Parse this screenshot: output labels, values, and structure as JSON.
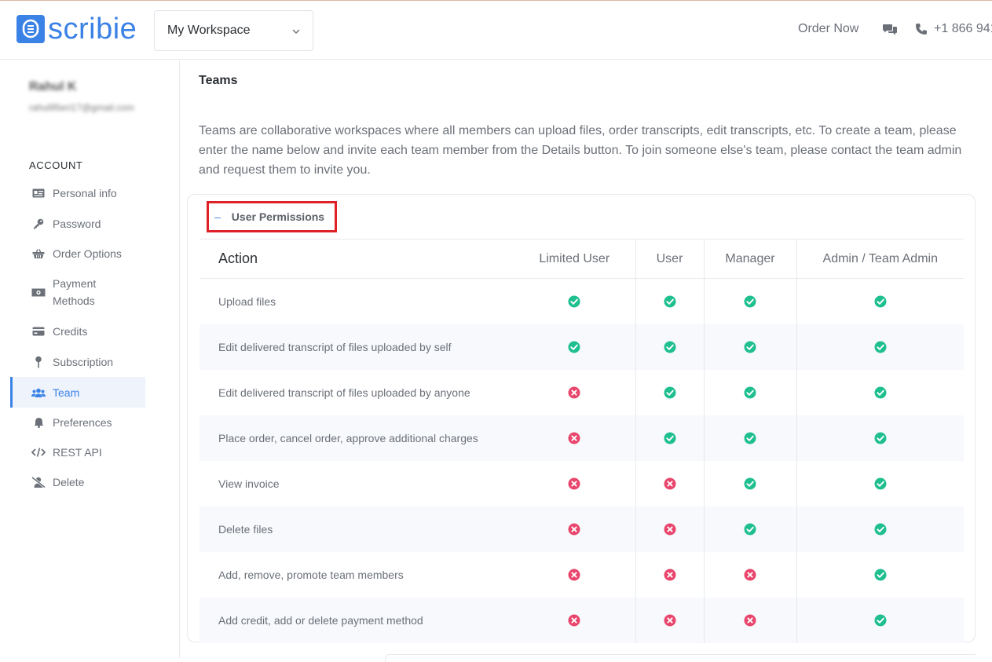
{
  "header": {
    "logo_text": "scribie",
    "workspace": "My Workspace",
    "order_now": "Order Now",
    "phone": "+1 866 941"
  },
  "sidebar": {
    "user_name": "Rahul K",
    "user_email": "rahul95eri17@gmail.com",
    "section": "ACCOUNT",
    "items": [
      {
        "label": "Personal info",
        "icon": "id-card-icon"
      },
      {
        "label": "Password",
        "icon": "key-icon"
      },
      {
        "label": "Order Options",
        "icon": "basket-icon"
      },
      {
        "label": "Payment Methods",
        "icon": "money-icon"
      },
      {
        "label": "Credits",
        "icon": "credit-card-icon"
      },
      {
        "label": "Subscription",
        "icon": "pin-icon"
      },
      {
        "label": "Team",
        "icon": "users-icon",
        "active": true
      },
      {
        "label": "Preferences",
        "icon": "bell-icon"
      },
      {
        "label": "REST API",
        "icon": "code-icon"
      },
      {
        "label": "Delete",
        "icon": "user-slash-icon"
      }
    ]
  },
  "main": {
    "title": "Teams",
    "intro": "Teams are collaborative workspaces where all members can upload files, order transcripts, edit transcripts, etc. To create a team, please enter the name below and invite each team member from the Details button. To join someone else's team, please contact the team admin and request them to invite you.",
    "permissions_toggle": "User Permissions",
    "permissions_toggle_symbol": "–",
    "columns": [
      "Action",
      "Limited User",
      "User",
      "Manager",
      "Admin / Team Admin"
    ],
    "rows": [
      {
        "action": "Upload files",
        "perms": [
          true,
          true,
          true,
          true
        ]
      },
      {
        "action": "Edit delivered transcript of files uploaded by self",
        "perms": [
          true,
          true,
          true,
          true
        ]
      },
      {
        "action": "Edit delivered transcript of files uploaded by anyone",
        "perms": [
          false,
          true,
          true,
          true
        ]
      },
      {
        "action": "Place order, cancel order, approve additional charges",
        "perms": [
          false,
          true,
          true,
          true
        ]
      },
      {
        "action": "View invoice",
        "perms": [
          false,
          false,
          true,
          true
        ]
      },
      {
        "action": "Delete files",
        "perms": [
          false,
          false,
          true,
          true
        ]
      },
      {
        "action": "Add, remove, promote team members",
        "perms": [
          false,
          false,
          false,
          true
        ]
      },
      {
        "action": "Add credit, add or delete payment method",
        "perms": [
          false,
          false,
          false,
          true
        ]
      }
    ]
  },
  "colors": {
    "brand": "#3b82e6",
    "check": "#1fbf8f",
    "cross": "#e8466c",
    "highlight_box": "#e02027"
  }
}
